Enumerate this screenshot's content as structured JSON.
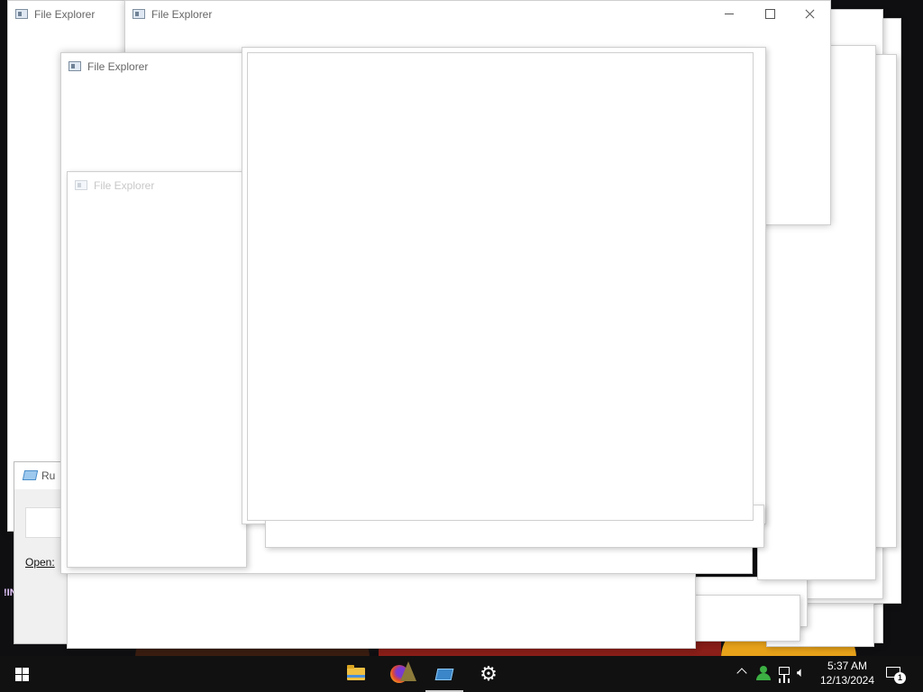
{
  "windows": {
    "w1_title": "File Explorer",
    "w2_title": "File Explorer",
    "w3_title": "File Explorer",
    "w4_title": "File Explorer"
  },
  "run_dialog": {
    "title": "Ru",
    "open_label": "Open:"
  },
  "desktop": {
    "fragment_text": "!IN"
  },
  "taskbar": {
    "apps": [
      "file-explorer",
      "firefox",
      "run",
      "settings"
    ],
    "active_app": "run"
  },
  "tray": {
    "time": "5:37 AM",
    "date": "12/13/2024",
    "notification_count": "1"
  }
}
